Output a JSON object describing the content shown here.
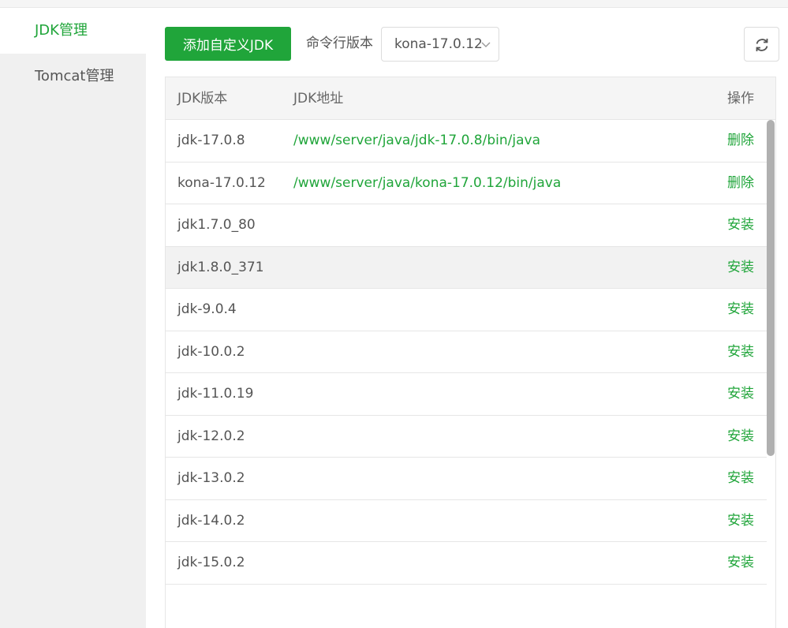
{
  "sidebar": {
    "items": [
      {
        "label": "JDK管理",
        "active": true
      },
      {
        "label": "Tomcat管理",
        "active": false
      }
    ]
  },
  "toolbar": {
    "add_label": "添加自定义JDK",
    "cli_label": "命令行版本",
    "cli_value": "kona-17.0.12"
  },
  "colors": {
    "accent": "#20a53a",
    "text": "#555555",
    "sidebar_bg": "#f0f0f0"
  },
  "table": {
    "headers": [
      "JDK版本",
      "JDK地址",
      "操作"
    ],
    "rows": [
      {
        "version": "jdk-17.0.8",
        "path": "/www/server/java/jdk-17.0.8/bin/java",
        "action": "删除"
      },
      {
        "version": "kona-17.0.12",
        "path": "/www/server/java/kona-17.0.12/bin/java",
        "action": "删除"
      },
      {
        "version": "jdk1.7.0_80",
        "path": "",
        "action": "安装"
      },
      {
        "version": "jdk1.8.0_371",
        "path": "",
        "action": "安装"
      },
      {
        "version": "jdk-9.0.4",
        "path": "",
        "action": "安装"
      },
      {
        "version": "jdk-10.0.2",
        "path": "",
        "action": "安装"
      },
      {
        "version": "jdk-11.0.19",
        "path": "",
        "action": "安装"
      },
      {
        "version": "jdk-12.0.2",
        "path": "",
        "action": "安装"
      },
      {
        "version": "jdk-13.0.2",
        "path": "",
        "action": "安装"
      },
      {
        "version": "jdk-14.0.2",
        "path": "",
        "action": "安装"
      },
      {
        "version": "jdk-15.0.2",
        "path": "",
        "action": "安装"
      }
    ]
  }
}
